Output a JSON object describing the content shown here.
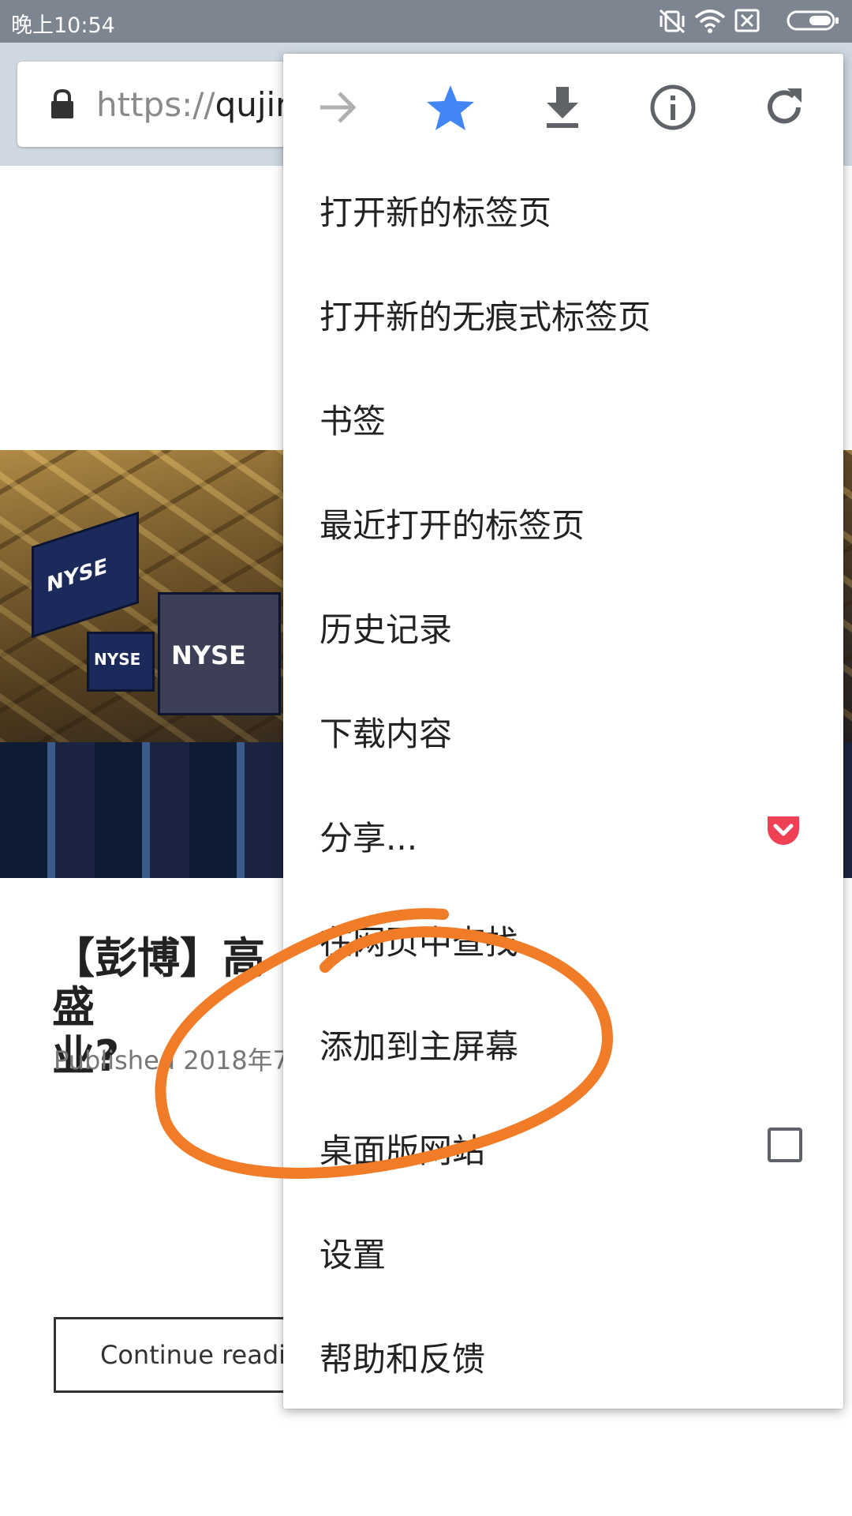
{
  "status_bar": {
    "time": "晚上10:54",
    "icons": [
      "vibrate-off-icon",
      "wifi-icon",
      "sim-off-icon",
      "battery-icon"
    ]
  },
  "browser": {
    "url_scheme": "https://",
    "url_host": "qujin",
    "lock_icon": "lock-icon"
  },
  "page": {
    "hero_labels": [
      "NYSE",
      "NYSE",
      "NYSE"
    ],
    "article_title": "【彭博】高盛\n业?",
    "published": "Published 2018年7",
    "continue_label": "Continue readi"
  },
  "menu": {
    "top_icons": [
      "forward-arrow-icon",
      "star-icon",
      "download-icon",
      "info-icon",
      "refresh-icon"
    ],
    "star_color": "#4285f4",
    "items": [
      {
        "label": "打开新的标签页"
      },
      {
        "label": "打开新的无痕式标签页"
      },
      {
        "label": "书签"
      },
      {
        "label": "最近打开的标签页"
      },
      {
        "label": "历史记录"
      },
      {
        "label": "下载内容"
      },
      {
        "label": "分享...",
        "trailing": "pocket-icon"
      },
      {
        "label": "在网页中查找"
      },
      {
        "label": "添加到主屏幕"
      },
      {
        "label": "桌面版网站",
        "trailing": "checkbox",
        "checked": false
      },
      {
        "label": "设置"
      },
      {
        "label": "帮助和反馈"
      }
    ]
  },
  "annotation_color": "#f07c28"
}
